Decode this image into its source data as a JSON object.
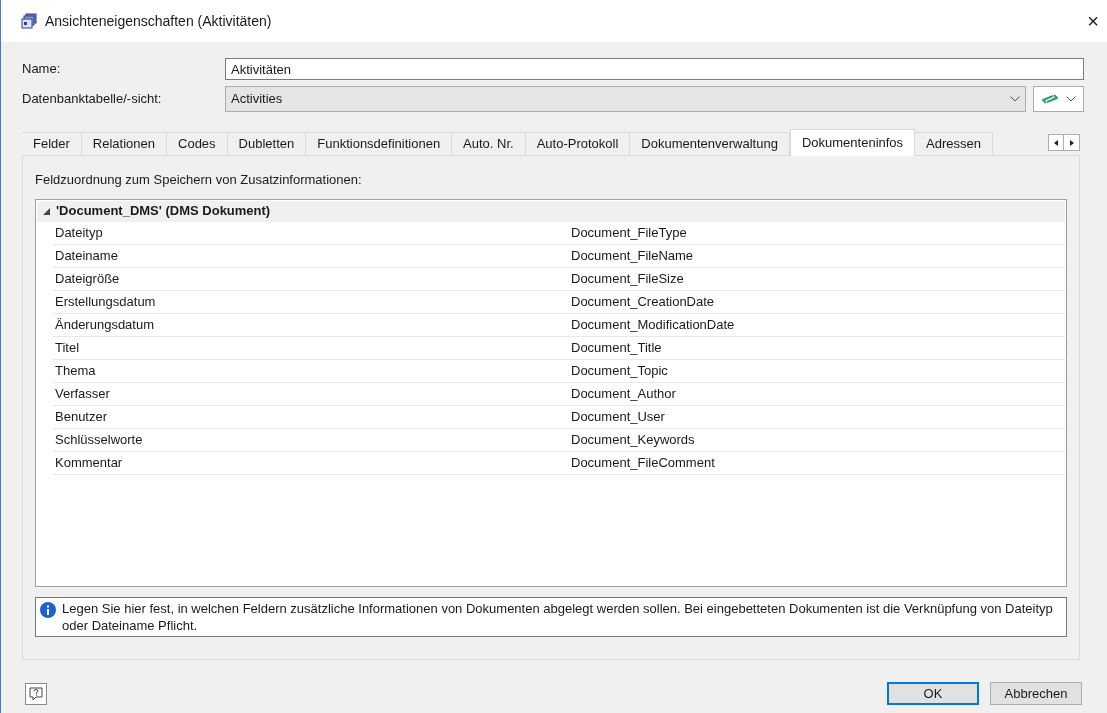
{
  "window": {
    "title": "Ansichteneigenschaften (Aktivitäten)",
    "close": "×"
  },
  "fields": [
    {
      "label": "Name:",
      "value": "Aktivitäten",
      "kind": "text"
    },
    {
      "label": "Datenbanktabelle/-sicht:",
      "value": "Activities",
      "kind": "combo"
    }
  ],
  "tabs": [
    {
      "label": "Felder",
      "selected": false
    },
    {
      "label": "Relationen",
      "selected": false
    },
    {
      "label": "Codes",
      "selected": false
    },
    {
      "label": "Dubletten",
      "selected": false
    },
    {
      "label": "Funktionsdefinitionen",
      "selected": false
    },
    {
      "label": "Auto. Nr.",
      "selected": false
    },
    {
      "label": "Auto-Protokoll",
      "selected": false
    },
    {
      "label": "Dokumentenverwaltung",
      "selected": false
    },
    {
      "label": "Dokumenteninfos",
      "selected": true
    },
    {
      "label": "Adressen",
      "selected": false
    }
  ],
  "panel": {
    "caption": "Feldzuordnung zum Speichern von Zusatzinformationen:",
    "group": {
      "title": "'Document_DMS' (DMS Dokument)",
      "expanded": true,
      "rows": [
        [
          "Dateityp",
          "Document_FileType"
        ],
        [
          "Dateiname",
          "Document_FileName"
        ],
        [
          "Dateigröße",
          "Document_FileSize"
        ],
        [
          "Erstellungsdatum",
          "Document_CreationDate"
        ],
        [
          "Änderungsdatum",
          "Document_ModificationDate"
        ],
        [
          "Titel",
          "Document_Title"
        ],
        [
          "Thema",
          "Document_Topic"
        ],
        [
          "Verfasser",
          "Document_Author"
        ],
        [
          "Benutzer",
          "Document_User"
        ],
        [
          "Schlüsselworte",
          "Document_Keywords"
        ],
        [
          "Kommentar",
          "Document_FileComment"
        ]
      ]
    },
    "info": "Legen Sie hier fest, in welchen Feldern zusätzliche Informationen von Dokumenten abgelegt werden sollen. Bei eingebetteten Dokumenten ist die Verknüpfung von Dateityp oder Dateiname Pflicht."
  },
  "buttons": [
    {
      "label": "OK",
      "default": true
    },
    {
      "label": "Abbrechen",
      "default": false
    }
  ]
}
